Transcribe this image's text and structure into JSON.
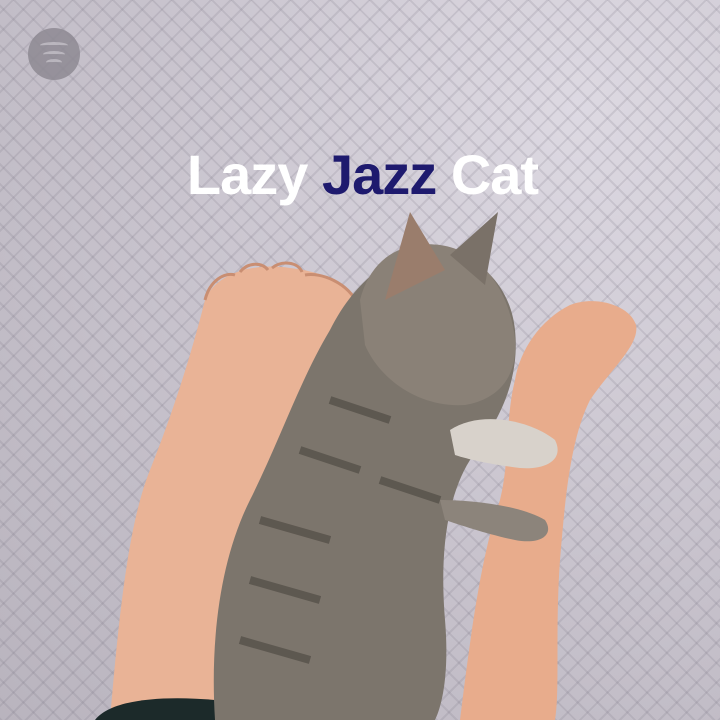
{
  "logo": {
    "icon": "spotify-logo-icon"
  },
  "title": {
    "part1": "Lazy ",
    "part2": "Jazz",
    "part3": " Cat"
  },
  "colors": {
    "accent": "#1e1a6e",
    "title": "#ffffff",
    "background": "#c9c5cf"
  }
}
